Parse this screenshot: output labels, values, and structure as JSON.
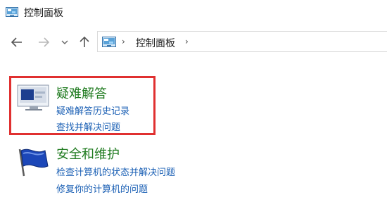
{
  "window": {
    "title": "控制面板",
    "icon": "control-panel-icon"
  },
  "navigation": {
    "back_icon": "arrow-left-icon",
    "forward_icon": "arrow-right-icon",
    "recent_icon": "chevron-down-icon",
    "up_icon": "arrow-up-icon"
  },
  "address_bar": {
    "icon": "control-panel-icon",
    "path": "控制面板"
  },
  "sections": [
    {
      "title": "疑难解答",
      "icon": "troubleshooting-icon",
      "links": [
        "疑难解答历史记录",
        "查找并解决问题"
      ]
    },
    {
      "title": "安全和维护",
      "icon": "security-flag-icon",
      "links": [
        "检查计算机的状态并解决问题",
        "修复你的计算机的问题"
      ]
    }
  ],
  "colors": {
    "title_green": "#1e7a1e",
    "link_blue": "#1a5fb4",
    "highlight_red": "#e03030"
  }
}
